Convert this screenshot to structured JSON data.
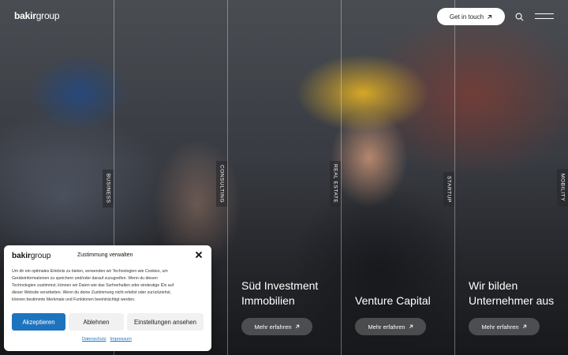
{
  "header": {
    "logo_bold": "bakir",
    "logo_light": "group",
    "cta_label": "Get in touch",
    "cta_icon": "arrow-up-right-icon",
    "search_icon": "search-icon",
    "menu_icon": "hamburger-menu-icon"
  },
  "columns": [
    {
      "label": "BUSINESS",
      "title": "",
      "button": ""
    },
    {
      "label": "CONSULTING",
      "title": "",
      "button": ""
    },
    {
      "label": "REAL ESTATE",
      "title_line1": "Süd Investment",
      "title_line2": "Immobilien",
      "button": "Mehr erfahren"
    },
    {
      "label": "STARTUP",
      "title_line1": "",
      "title_line2": "Venture Capital",
      "button": "Mehr erfahren"
    },
    {
      "label": "MOBILITY",
      "title_line1": "Wir bilden",
      "title_line2": "Unternehmer aus",
      "button": "Mehr erfahren"
    }
  ],
  "cookie": {
    "logo_bold": "bakir",
    "logo_light": "group",
    "title": "Zustimmung verwalten",
    "text_lines": [
      "Um dir ein optimales Erlebnis zu bieten, verwenden wir Technologien wie Cookies, um",
      "Geräteinformationen zu speichern und/oder darauf zuzugreifen. Wenn du diesen",
      "Technologien zustimmst, können wir Daten wie das Surfverhalten oder eindeutige IDs auf",
      "dieser Website verarbeiten. Wenn du deine Zustimmung nicht erteilst oder zurückziehst,",
      "können bestimmte Merkmale und Funktionen beeinträchtigt werden."
    ],
    "accept_label": "Akzeptieren",
    "deny_label": "Ablehnen",
    "settings_label": "Einstellungen ansehen",
    "link_privacy": "Datenschutz",
    "link_imprint": "Impressum"
  },
  "colors": {
    "accent": "#1e73be",
    "helmet": "#f5be28"
  }
}
